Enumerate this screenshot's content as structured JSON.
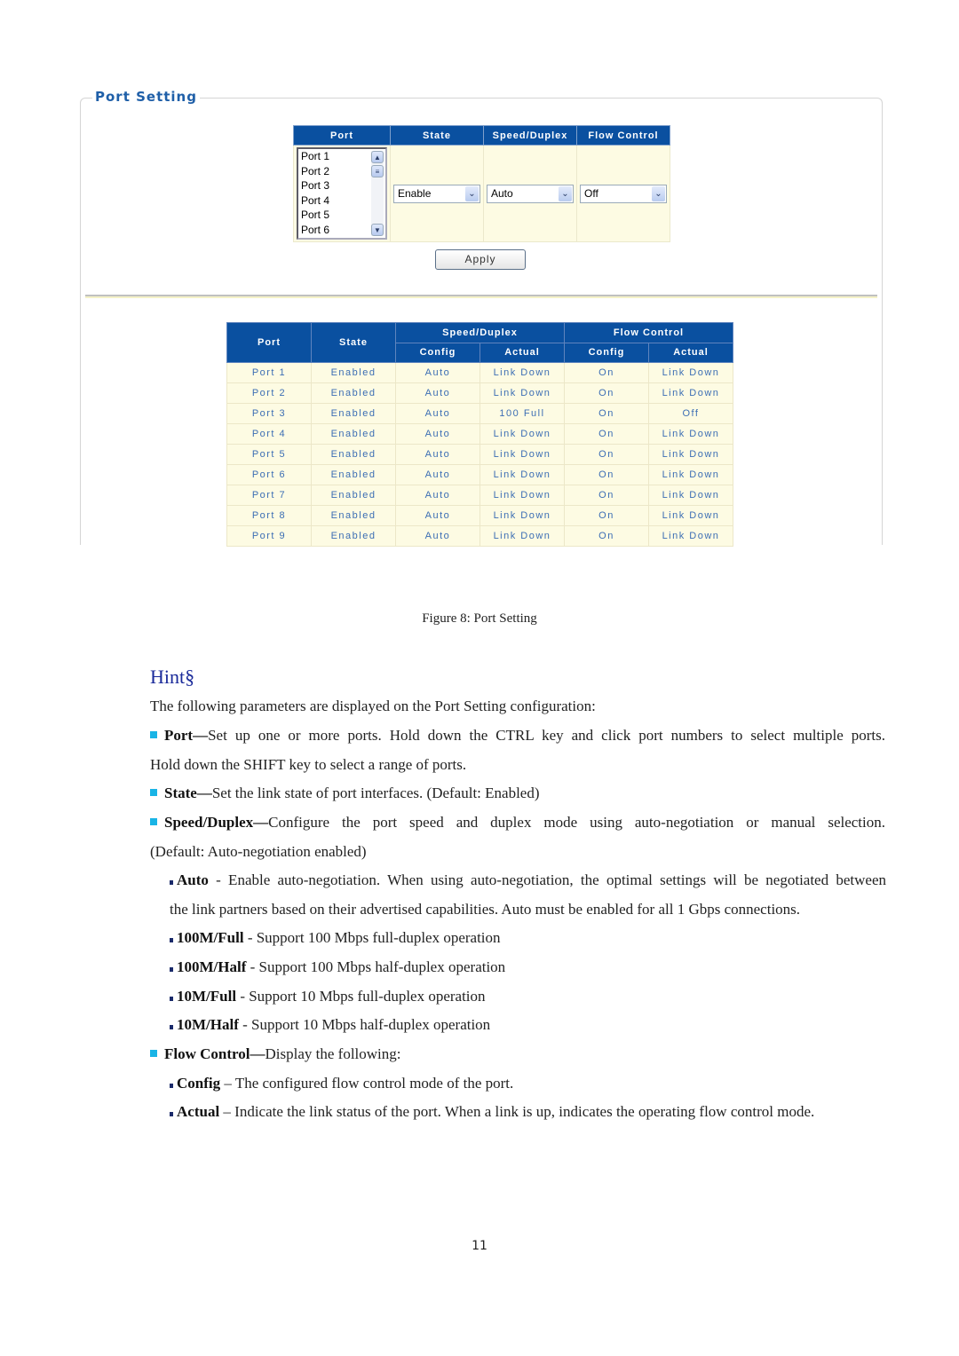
{
  "panel": {
    "title": "Port Setting",
    "config_table": {
      "headers": [
        "Port",
        "State",
        "Speed/Duplex",
        "Flow Control"
      ],
      "port_list": [
        "Port 1",
        "Port 2",
        "Port 3",
        "Port 4",
        "Port 5",
        "Port 6"
      ],
      "state_value": "Enable",
      "speed_value": "Auto",
      "flow_value": "Off"
    },
    "apply_label": "Apply",
    "status_table": {
      "headers": {
        "port": "Port",
        "state": "State",
        "speed_group": "Speed/Duplex",
        "flow_group": "Flow Control",
        "config": "Config",
        "actual": "Actual"
      },
      "rows": [
        [
          "Port 1",
          "Enabled",
          "Auto",
          "Link Down",
          "On",
          "Link Down"
        ],
        [
          "Port 2",
          "Enabled",
          "Auto",
          "Link Down",
          "On",
          "Link Down"
        ],
        [
          "Port 3",
          "Enabled",
          "Auto",
          "100 Full",
          "On",
          "Off"
        ],
        [
          "Port 4",
          "Enabled",
          "Auto",
          "Link Down",
          "On",
          "Link Down"
        ],
        [
          "Port 5",
          "Enabled",
          "Auto",
          "Link Down",
          "On",
          "Link Down"
        ],
        [
          "Port 6",
          "Enabled",
          "Auto",
          "Link Down",
          "On",
          "Link Down"
        ],
        [
          "Port 7",
          "Enabled",
          "Auto",
          "Link Down",
          "On",
          "Link Down"
        ],
        [
          "Port 8",
          "Enabled",
          "Auto",
          "Link Down",
          "On",
          "Link Down"
        ],
        [
          "Port 9",
          "Enabled",
          "Auto",
          "Link Down",
          "On",
          "Link Down"
        ]
      ]
    }
  },
  "doc": {
    "caption": "Figure 8: Port Setting",
    "hint_heading": "Hint§",
    "intro": "The following parameters are displayed on the Port Setting configuration:",
    "port": {
      "term": "Port—",
      "text_line1": "Set up one or more ports. Hold down the CTRL key and click port numbers to select multiple ports.",
      "text_line2": "Hold down the SHIFT key to select a range of ports."
    },
    "state": {
      "term": "State—",
      "text": "Set the link state of port interfaces. (Default: Enabled)"
    },
    "speed": {
      "term": "Speed/Duplex—",
      "text_line1": "Configure the port speed and duplex mode using auto-negotiation or manual selection.",
      "text_line2": "(Default: Auto-negotiation enabled)"
    },
    "speed_items": [
      {
        "term": "Auto",
        "text": " - Enable auto-negotiation. When using auto-negotiation, the optimal settings will be negotiated between",
        "text2": "the link partners based on their advertised capabilities. Auto must be enabled for all 1 Gbps connections."
      },
      {
        "term": "100M/Full",
        "text": " - Support 100 Mbps full-duplex operation"
      },
      {
        "term": "100M/Half",
        "text": " - Support 100 Mbps half-duplex operation"
      },
      {
        "term": "10M/Full",
        "text": " - Support 10 Mbps full-duplex operation"
      },
      {
        "term": "10M/Half",
        "text": " - Support 10 Mbps half-duplex operation"
      }
    ],
    "flow": {
      "term": "Flow Control—",
      "text": "Display the following:"
    },
    "flow_items": [
      {
        "term": "Config",
        "text": " – The configured flow control mode of the port."
      },
      {
        "term": "Actual",
        "text": " – Indicate the link status of the port. When a link is up, indicates the operating flow control mode."
      }
    ],
    "page_number": "11"
  },
  "colors": {
    "header_blue": "#0a50a0",
    "cell_cream": "#fdfbe3",
    "cell_text": "#3c6eb4",
    "bullet_cyan": "#19b4e6",
    "hint_blue": "#1a2a9a"
  }
}
